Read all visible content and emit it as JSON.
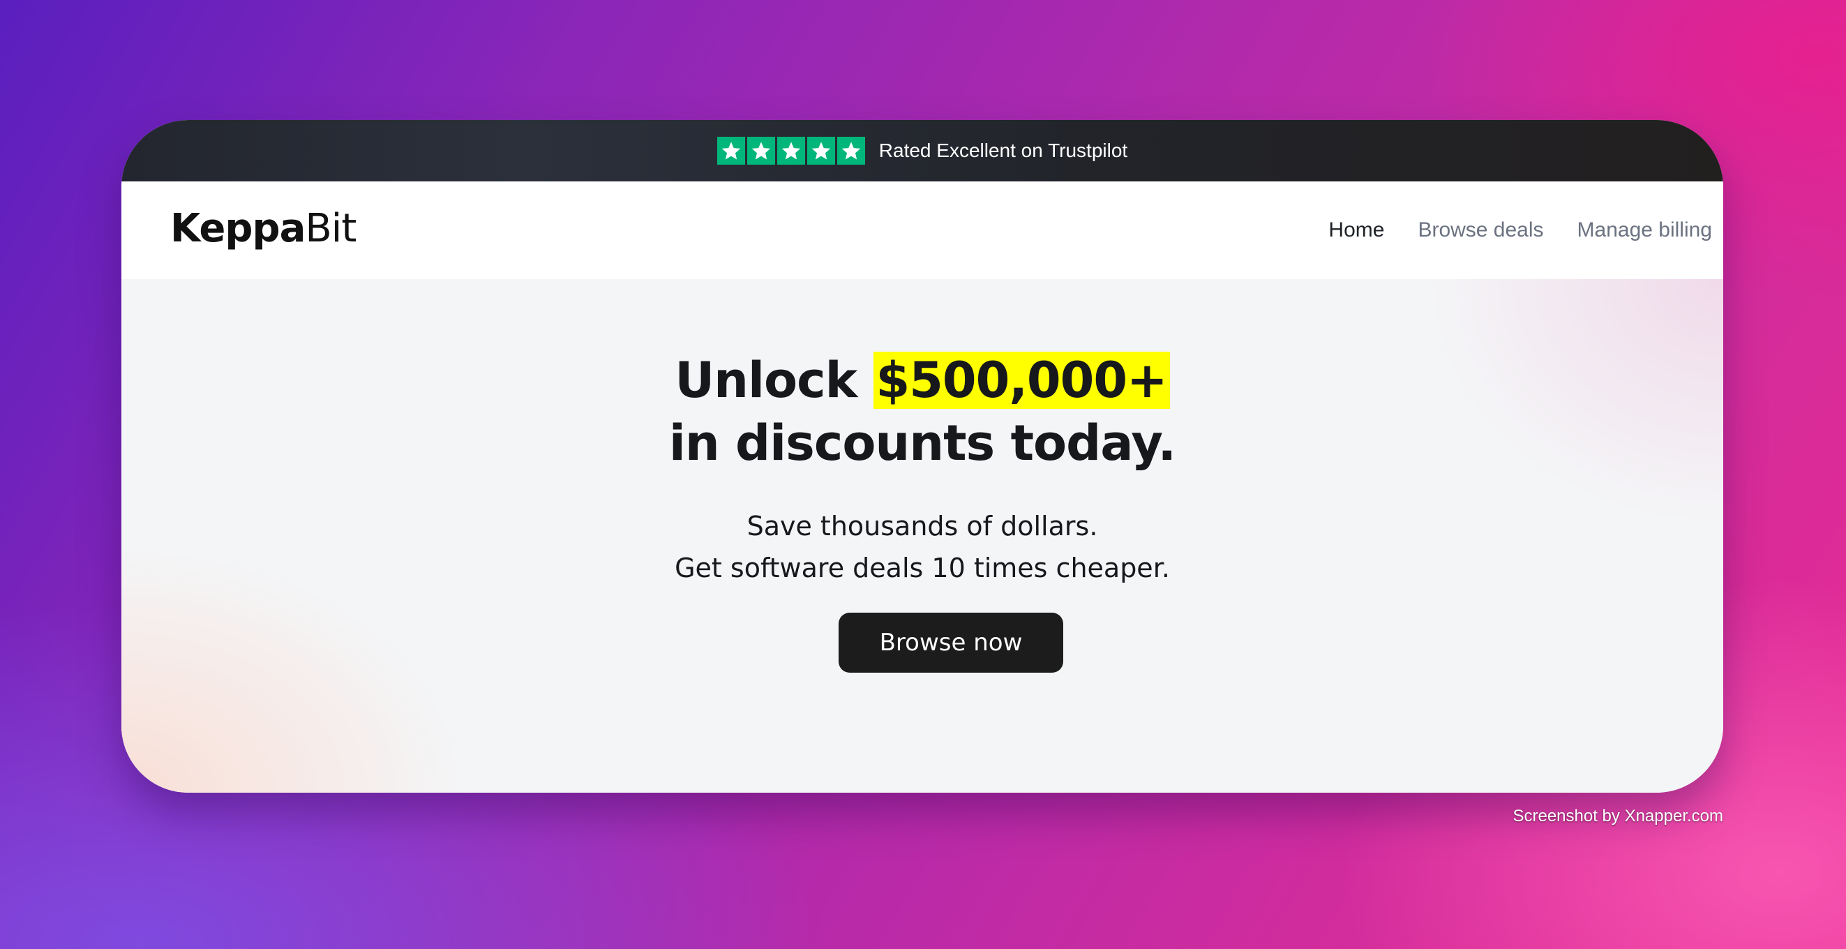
{
  "trustbar": {
    "stars": 5,
    "text": "Rated Excellent on Trustpilot",
    "star_color": "#00b67a"
  },
  "logo": {
    "bold": "Keppa",
    "light": "Bit"
  },
  "nav": {
    "items": [
      {
        "label": "Home",
        "active": true
      },
      {
        "label": "Browse deals",
        "active": false
      },
      {
        "label": "Manage billing",
        "active": false
      }
    ]
  },
  "hero": {
    "headline_prefix": "Unlock ",
    "headline_highlight": "$500,000+",
    "headline_line2": "in discounts today.",
    "sub_line1": "Save thousands of dollars.",
    "sub_line2": "Get software deals 10 times cheaper.",
    "cta_label": "Browse now",
    "highlight_color": "#ffff00"
  },
  "credit": "Screenshot by Xnapper.com"
}
